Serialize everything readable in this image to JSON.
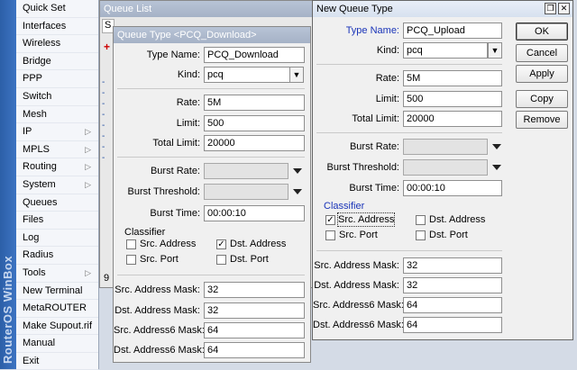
{
  "brand": {
    "text": "RouterOS WinBox"
  },
  "menu": {
    "items": [
      {
        "label": "Quick Set",
        "submenu": false
      },
      {
        "label": "Interfaces",
        "submenu": false
      },
      {
        "label": "Wireless",
        "submenu": false
      },
      {
        "label": "Bridge",
        "submenu": false
      },
      {
        "label": "PPP",
        "submenu": false
      },
      {
        "label": "Switch",
        "submenu": false
      },
      {
        "label": "Mesh",
        "submenu": false
      },
      {
        "label": "IP",
        "submenu": true
      },
      {
        "label": "MPLS",
        "submenu": true
      },
      {
        "label": "Routing",
        "submenu": true
      },
      {
        "label": "System",
        "submenu": true
      },
      {
        "label": "Queues",
        "submenu": false
      },
      {
        "label": "Files",
        "submenu": false
      },
      {
        "label": "Log",
        "submenu": false
      },
      {
        "label": "Radius",
        "submenu": false
      },
      {
        "label": "Tools",
        "submenu": true
      },
      {
        "label": "New Terminal",
        "submenu": false
      },
      {
        "label": "MetaROUTER",
        "submenu": false
      },
      {
        "label": "Make Supout.rif",
        "submenu": false
      },
      {
        "label": "Manual",
        "submenu": false
      },
      {
        "label": "Exit",
        "submenu": false
      }
    ]
  },
  "queue_list": {
    "title": "Queue List",
    "tab_initial": "S",
    "status_count": "9"
  },
  "download_window": {
    "title": "Queue Type <PCQ_Download>",
    "type_name_label": "Type Name:",
    "type_name": "PCQ_Download",
    "kind_label": "Kind:",
    "kind": "pcq",
    "rate_label": "Rate:",
    "rate": "5M",
    "limit_label": "Limit:",
    "limit": "500",
    "total_limit_label": "Total Limit:",
    "total_limit": "20000",
    "burst_rate_label": "Burst Rate:",
    "burst_threshold_label": "Burst Threshold:",
    "burst_time_label": "Burst Time:",
    "burst_time": "00:00:10",
    "classifier_label": "Classifier",
    "src_address_label": "Src. Address",
    "dst_address_label": "Dst. Address",
    "src_port_label": "Src. Port",
    "dst_port_label": "Dst. Port",
    "src_address_checked": false,
    "dst_address_checked": true,
    "src_port_checked": false,
    "dst_port_checked": false,
    "src_mask_label": "Src. Address Mask:",
    "src_mask": "32",
    "dst_mask_label": "Dst. Address Mask:",
    "dst_mask": "32",
    "src6_mask_label": "Src. Address6 Mask:",
    "src6_mask": "64",
    "dst6_mask_label": "Dst. Address6 Mask:",
    "dst6_mask": "64"
  },
  "upload_window": {
    "title": "New Queue Type",
    "type_name_label": "Type Name:",
    "type_name": "PCQ_Upload",
    "kind_label": "Kind:",
    "kind": "pcq",
    "rate_label": "Rate:",
    "rate": "5M",
    "limit_label": "Limit:",
    "limit": "500",
    "total_limit_label": "Total Limit:",
    "total_limit": "20000",
    "burst_rate_label": "Burst Rate:",
    "burst_threshold_label": "Burst Threshold:",
    "burst_time_label": "Burst Time:",
    "burst_time": "00:00:10",
    "classifier_label": "Classifier",
    "src_address_label": "Src. Address",
    "dst_address_label": "Dst. Address",
    "src_port_label": "Src. Port",
    "dst_port_label": "Dst. Port",
    "src_address_checked": true,
    "dst_address_checked": false,
    "src_port_checked": false,
    "dst_port_checked": false,
    "src_mask_label": "Src. Address Mask:",
    "src_mask": "32",
    "dst_mask_label": "Dst. Address Mask:",
    "dst_mask": "32",
    "src6_mask_label": "Src. Address6 Mask:",
    "src6_mask": "64",
    "dst6_mask_label": "Dst. Address6 Mask:",
    "dst6_mask": "64",
    "buttons": {
      "ok": "OK",
      "cancel": "Cancel",
      "apply": "Apply",
      "copy": "Copy",
      "remove": "Remove"
    }
  },
  "icons": {
    "dropdown": "dropdown-arrow-icon",
    "submenu": "chevron-right-icon",
    "restore": "restore-icon",
    "close": "close-icon"
  }
}
